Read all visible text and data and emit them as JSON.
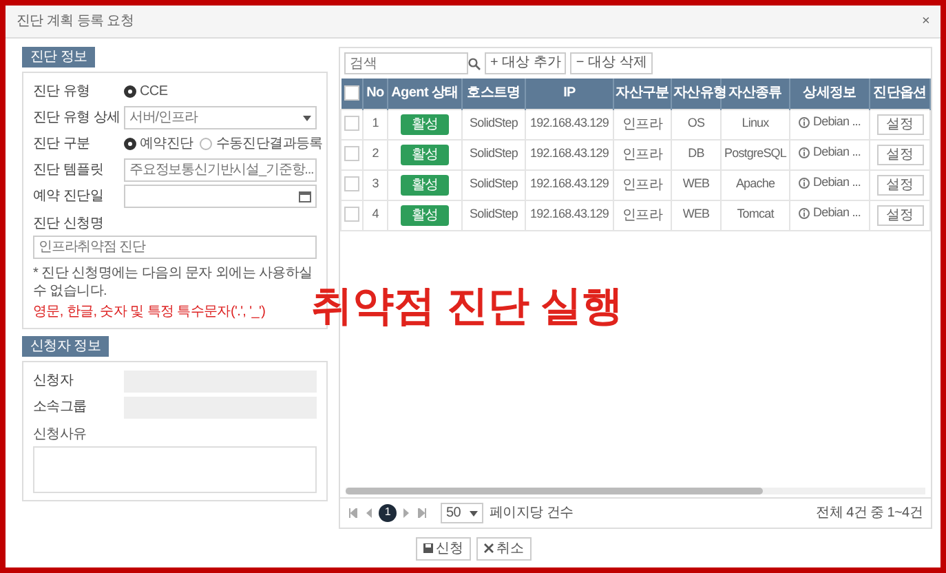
{
  "window": {
    "title": "진단 계획 등록 요청",
    "close": "×"
  },
  "diagnosis_info": {
    "title": "진단 정보",
    "fields": [
      {
        "kind": "radio",
        "label": "진단 유형",
        "options": [
          {
            "label": "CCE",
            "selected": true
          }
        ]
      },
      {
        "kind": "select",
        "label": "진단 유형 상세",
        "value": "서버/인프라"
      },
      {
        "kind": "radio",
        "label": "진단 구분",
        "options": [
          {
            "label": "예약진단",
            "selected": true
          },
          {
            "label": "수동진단결과등록",
            "selected": false
          }
        ]
      },
      {
        "kind": "select",
        "label": "진단 템플릿",
        "value": "주요정보통신기반시설_기준항..."
      },
      {
        "kind": "date",
        "label": "예약 진단일"
      }
    ],
    "name_field": {
      "label": "진단 신청명",
      "value": "인프라취약점 진단"
    },
    "note": "* 진단 신청명에는 다음의 문자 외에는 사용하실 수 없습니다.",
    "warning": "영문, 한글, 숫자 및 특정 특수문자('.', '_')"
  },
  "applicant_info": {
    "title": "신청자 정보",
    "fields": [
      {
        "label": "신청자"
      },
      {
        "label": "소속그룹"
      }
    ],
    "reason": {
      "label": "신청사유"
    }
  },
  "toolbar": {
    "search_placeholder": "검색",
    "buttons": [
      {
        "icon": "+",
        "label": "대상 추가"
      },
      {
        "icon": "−",
        "label": "대상 삭제"
      }
    ]
  },
  "table": {
    "all_selected": false,
    "columns": [
      {
        "label": "No",
        "kind": "text"
      },
      {
        "label": "Agent 상태",
        "kind": "badge"
      },
      {
        "label": "호스트명",
        "kind": "text"
      },
      {
        "label": "IP",
        "kind": "text"
      },
      {
        "label": "자산구분",
        "kind": "text"
      },
      {
        "label": "자산유형",
        "kind": "text"
      },
      {
        "label": "자산종류",
        "kind": "text"
      },
      {
        "label": "상세정보",
        "kind": "info"
      },
      {
        "label": "진단옵션",
        "kind": "button"
      }
    ],
    "rows": [
      {
        "selected": false,
        "cells": [
          "1",
          "활성",
          "SolidStep",
          "192.168.43.129",
          "인프라",
          "OS",
          "Linux",
          "Debian ...",
          "설정"
        ]
      },
      {
        "selected": false,
        "cells": [
          "2",
          "활성",
          "SolidStep",
          "192.168.43.129",
          "인프라",
          "DB",
          "PostgreSQL",
          "Debian ...",
          "설정"
        ]
      },
      {
        "selected": false,
        "cells": [
          "3",
          "활성",
          "SolidStep",
          "192.168.43.129",
          "인프라",
          "WEB",
          "Apache",
          "Debian ...",
          "설정"
        ]
      },
      {
        "selected": false,
        "cells": [
          "4",
          "활성",
          "SolidStep",
          "192.168.43.129",
          "인프라",
          "WEB",
          "Tomcat",
          "Debian ...",
          "설정"
        ]
      }
    ]
  },
  "pagination": {
    "current": "1",
    "page_size": "50",
    "page_size_label": "페이지당 건수",
    "summary": "전체 4건 중 1~4건"
  },
  "actions": [
    {
      "kind": "submit",
      "label": "신청"
    },
    {
      "kind": "cancel",
      "label": "취소"
    }
  ],
  "annotation": "취약점 진단 실행"
}
